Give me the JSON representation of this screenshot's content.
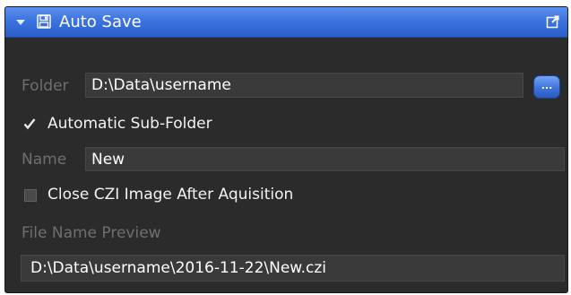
{
  "header": {
    "title": "Auto Save",
    "collapse_icon": "chevron-down-icon",
    "title_icon": "floppy-disk-icon",
    "popout_icon": "popout-icon",
    "accent_color": "#3d73de"
  },
  "folder": {
    "label": "Folder",
    "value": "D:\\Data\\username",
    "browse_label": "..."
  },
  "sub_folder": {
    "label": "Automatic Sub-Folder",
    "checked": true
  },
  "name": {
    "label": "Name",
    "value": "New"
  },
  "close_czi": {
    "label": "Close CZI Image After Aquisition",
    "checked": false
  },
  "preview": {
    "label": "File Name Preview",
    "value": "D:\\Data\\username\\2016-11-22\\New.czi"
  }
}
